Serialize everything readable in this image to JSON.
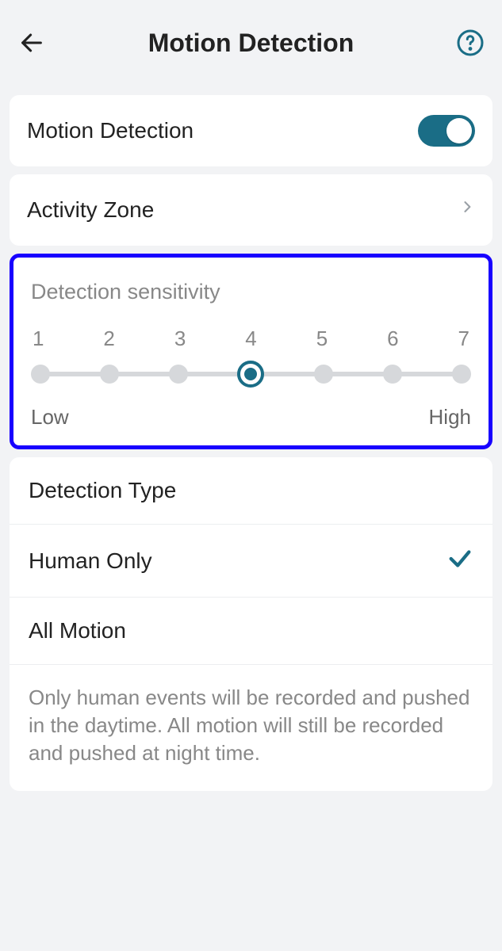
{
  "header": {
    "title": "Motion Detection"
  },
  "toggleRow": {
    "label": "Motion Detection",
    "enabled": true
  },
  "activityZone": {
    "label": "Activity Zone"
  },
  "sensitivity": {
    "title": "Detection sensitivity",
    "levels": [
      "1",
      "2",
      "3",
      "4",
      "5",
      "6",
      "7"
    ],
    "selected": 4,
    "lowLabel": "Low",
    "highLabel": "High"
  },
  "detectionType": {
    "header": "Detection Type",
    "options": {
      "humanOnly": {
        "label": "Human Only",
        "selected": true
      },
      "allMotion": {
        "label": "All Motion",
        "selected": false
      }
    },
    "description": "Only human events will be recorded and pushed in the daytime. All motion will still be recorded and pushed at night time."
  }
}
